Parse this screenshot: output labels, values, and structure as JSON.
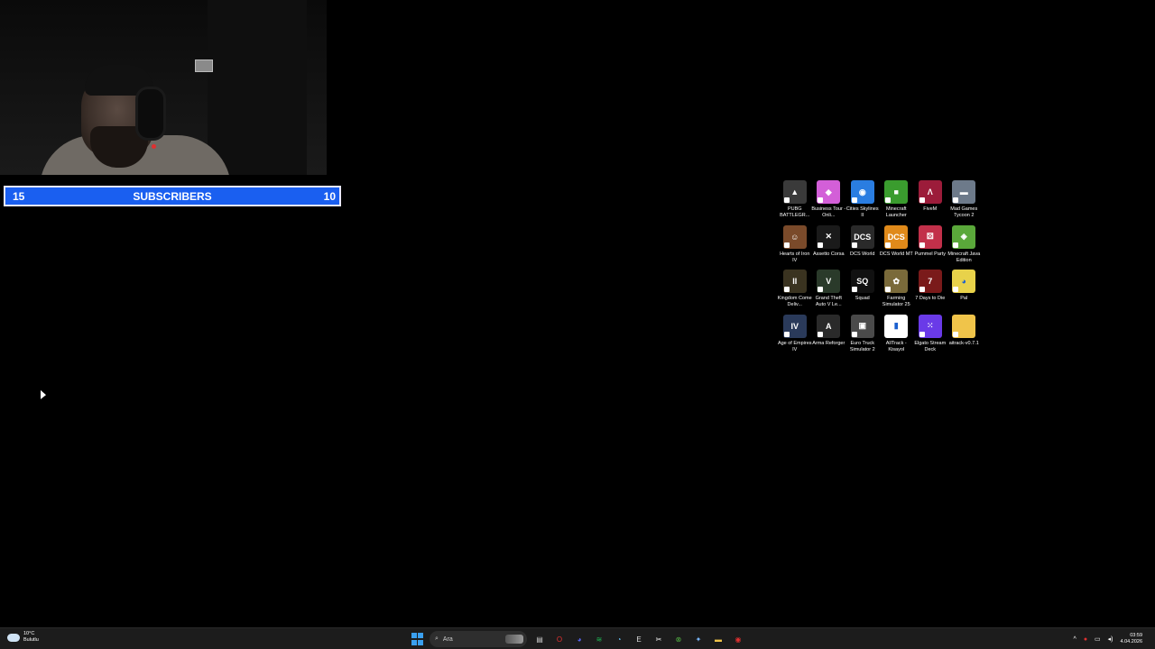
{
  "subscriber_bar": {
    "left_count": "15",
    "label": "SUBSCRIBERS",
    "right_count": "10",
    "color": "#1a5ff0"
  },
  "desktop_icons": [
    {
      "label": "PUBG BATTLEGR...",
      "icon": "pubg-icon",
      "color": "#3a3a3a",
      "glyph": "▲"
    },
    {
      "label": "Business Tour - Onli...",
      "icon": "business-tour-icon",
      "color": "#d35fd8",
      "glyph": "◆"
    },
    {
      "label": "Cities Skylines II",
      "icon": "cities-skylines-icon",
      "color": "#2a7de1",
      "glyph": "◉"
    },
    {
      "label": "Minecraft Launcher",
      "icon": "minecraft-launcher-icon",
      "color": "#3a9c2e",
      "glyph": "■"
    },
    {
      "label": "FiveM",
      "icon": "fivem-icon",
      "color": "#9c1c3a",
      "glyph": "Λ"
    },
    {
      "label": "Mad Games Tycoon 2",
      "icon": "mad-games-tycoon-icon",
      "color": "#6d7a8a",
      "glyph": "▬"
    },
    {
      "label": "Hearts of Iron IV",
      "icon": "hearts-of-iron-icon",
      "color": "#7a4a2a",
      "glyph": "☺"
    },
    {
      "label": "Assetto Corsa",
      "icon": "assetto-corsa-icon",
      "color": "#1a1a1a",
      "glyph": "✕"
    },
    {
      "label": "DCS World",
      "icon": "dcs-world-icon",
      "color": "#2a2a2a",
      "glyph": "DCS"
    },
    {
      "label": "DCS World MT",
      "icon": "dcs-world-mt-icon",
      "color": "#e08a1a",
      "glyph": "DCS"
    },
    {
      "label": "Pummel Party",
      "icon": "pummel-party-icon",
      "color": "#c2304a",
      "glyph": "⚄"
    },
    {
      "label": "Minecraft Java Edition",
      "icon": "minecraft-java-icon",
      "color": "#5aa83a",
      "glyph": "◈"
    },
    {
      "label": "Kingdom Come Deliv...",
      "icon": "kingdom-come-icon",
      "color": "#3a3320",
      "glyph": "II"
    },
    {
      "label": "Grand Theft Auto V Le...",
      "icon": "gta-v-icon",
      "color": "#2a3a2a",
      "glyph": "V"
    },
    {
      "label": "Squad",
      "icon": "squad-icon",
      "color": "#111111",
      "glyph": "SQ"
    },
    {
      "label": "Farming Simulator 25",
      "icon": "farming-simulator-icon",
      "color": "#7a6a3a",
      "glyph": "✿"
    },
    {
      "label": "7 Days to Die",
      "icon": "7-days-to-die-icon",
      "color": "#7a1a1a",
      "glyph": "7"
    },
    {
      "label": "Pal",
      "icon": "pal-icon",
      "color": "#e8d24a",
      "glyph": "◕"
    },
    {
      "label": "Age of Empires IV",
      "icon": "age-of-empires-icon",
      "color": "#2a3a5a",
      "glyph": "IV"
    },
    {
      "label": "Arma Reforger",
      "icon": "arma-reforger-icon",
      "color": "#2a2a2a",
      "glyph": "A"
    },
    {
      "label": "Euro Truck Simulator 2",
      "icon": "euro-truck-icon",
      "color": "#4a4a4a",
      "glyph": "▣"
    },
    {
      "label": "AllTrack - Kisayol",
      "icon": "alltrack-icon",
      "color": "#ffffff",
      "glyph": "▮"
    },
    {
      "label": "Elgato Stream Deck",
      "icon": "stream-deck-icon",
      "color": "#6a3ae8",
      "glyph": "⁙"
    },
    {
      "label": "aitrack-v0.7.1",
      "icon": "folder-icon",
      "color": "#f0c44a",
      "glyph": ""
    }
  ],
  "taskbar": {
    "weather_temp": "10°C",
    "weather_desc": "Bulutlu",
    "search_placeholder": "Ara",
    "apps": [
      {
        "icon": "file-explorer-icon",
        "glyph": "▤",
        "color": "#cccccc"
      },
      {
        "icon": "opera-icon",
        "glyph": "O",
        "color": "#e03030"
      },
      {
        "icon": "discord-icon",
        "glyph": "◕",
        "color": "#5865f2"
      },
      {
        "icon": "spotify-icon",
        "glyph": "≋",
        "color": "#1db954"
      },
      {
        "icon": "steam-icon",
        "glyph": "◔",
        "color": "#66c0f4"
      },
      {
        "icon": "epic-games-icon",
        "glyph": "E",
        "color": "#dddddd"
      },
      {
        "icon": "capcut-icon",
        "glyph": "✂",
        "color": "#ffffff"
      },
      {
        "icon": "xbox-icon",
        "glyph": "⊗",
        "color": "#52b043"
      },
      {
        "icon": "copilot-icon",
        "glyph": "✦",
        "color": "#7ab8ff"
      },
      {
        "icon": "folder-icon",
        "glyph": "▬",
        "color": "#f0c44a"
      },
      {
        "icon": "obs-icon",
        "glyph": "◉",
        "color": "#e03030"
      }
    ],
    "time": "03:59",
    "date": "4.04.2026"
  }
}
